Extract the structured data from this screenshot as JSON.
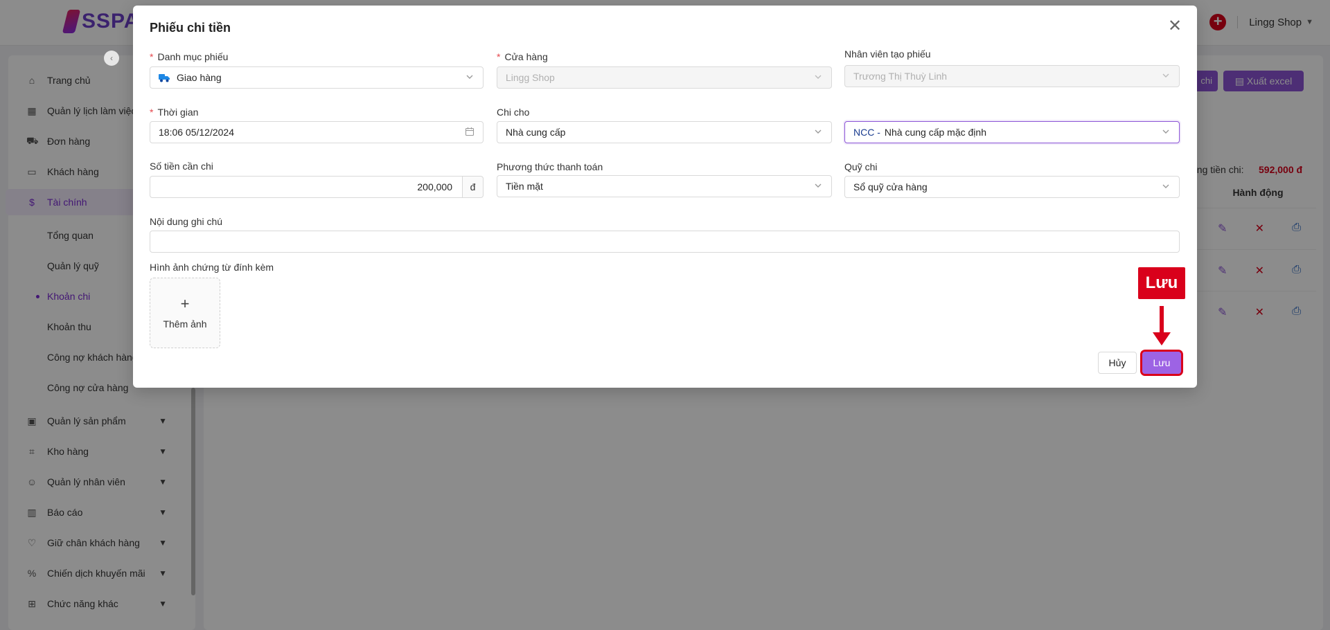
{
  "app": {
    "logo_text": "SSPA",
    "shop_name": "Lingg Shop"
  },
  "sidebar": {
    "items": [
      {
        "label": "Trang chủ",
        "icon": "home-icon"
      },
      {
        "label": "Quản lý lịch làm việc",
        "icon": "calendar-icon"
      },
      {
        "label": "Đơn hàng",
        "icon": "cart-icon"
      },
      {
        "label": "Khách hàng",
        "icon": "id-card-icon"
      },
      {
        "label": "Tài chính",
        "icon": "dollar-icon",
        "active": true
      },
      {
        "label": "Quản lý sản phẩm",
        "icon": "box-icon"
      },
      {
        "label": "Kho hàng",
        "icon": "warehouse-icon"
      },
      {
        "label": "Quản lý nhân viên",
        "icon": "users-icon"
      },
      {
        "label": "Báo cáo",
        "icon": "chart-icon"
      },
      {
        "label": "Giữ chân khách hàng",
        "icon": "heart-icon"
      },
      {
        "label": "Chiến dịch khuyến mãi",
        "icon": "discount-icon"
      },
      {
        "label": "Chức năng khác",
        "icon": "grid-icon"
      }
    ],
    "sub_items": [
      {
        "label": "Tổng quan"
      },
      {
        "label": "Quản lý quỹ"
      },
      {
        "label": "Khoản chi",
        "active": true
      },
      {
        "label": "Khoản thu"
      },
      {
        "label": "Công nợ khách hàng"
      },
      {
        "label": "Công nợ cửa hàng"
      }
    ]
  },
  "main": {
    "chi_button": "chi",
    "export_button": "Xuất excel",
    "total_label": "ổng tiền chi:",
    "total_value": "592,000 đ",
    "action_header": "Hành động"
  },
  "modal": {
    "title": "Phiếu chi tiền",
    "category": {
      "label": "Danh mục phiếu",
      "value": "Giao hàng"
    },
    "store": {
      "label": "Cửa hàng",
      "value": "Lingg Shop"
    },
    "creator": {
      "label": "Nhân viên tạo phiếu",
      "value": "Trương Thị Thuỳ Linh"
    },
    "time": {
      "label": "Thời gian",
      "value": "18:06 05/12/2024"
    },
    "pay_to": {
      "label": "Chi cho",
      "value": "Nhà cung cấp"
    },
    "supplier": {
      "prefix": "NCC -",
      "value": "Nhà cung cấp mặc định"
    },
    "amount": {
      "label": "Số tiền cần chi",
      "value": "200,000",
      "suffix": "đ"
    },
    "payment_method": {
      "label": "Phương thức thanh toán",
      "value": "Tiền mặt"
    },
    "fund": {
      "label": "Quỹ chi",
      "value": "Sổ quỹ cửa hàng"
    },
    "note": {
      "label": "Nội dung ghi chú",
      "value": ""
    },
    "attachments": {
      "label": "Hình ảnh chứng từ đính kèm",
      "add_label": "Thêm ảnh"
    },
    "cancel_label": "Hủy",
    "save_label": "Lưu"
  },
  "annotation": {
    "callout_label": "Lưu",
    "color": "#d9001b"
  },
  "colors": {
    "accent": "#8c55d6",
    "danger": "#d9001b"
  }
}
